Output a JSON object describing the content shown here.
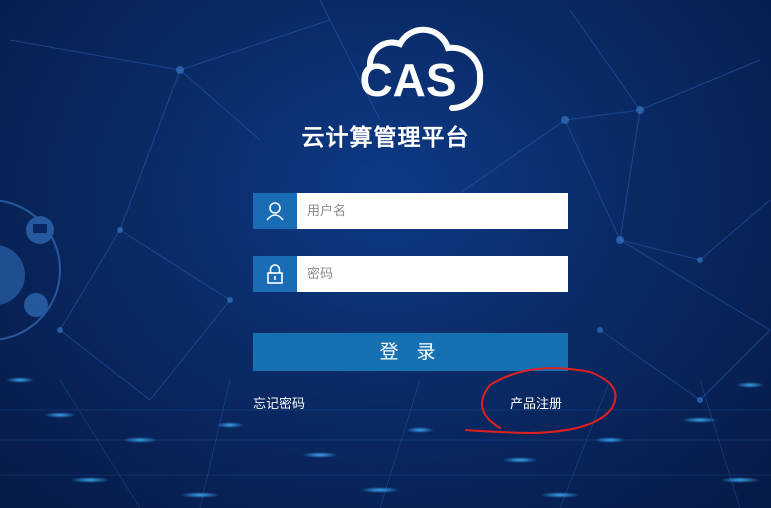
{
  "app": {
    "logo_text": "CAS",
    "subtitle": "云计算管理平台"
  },
  "form": {
    "username_placeholder": "用户名",
    "username_value": "",
    "password_placeholder": "密码",
    "password_value": "",
    "login_label": "登 录"
  },
  "links": {
    "forgot_password": "忘记密码",
    "product_register": "产品注册"
  },
  "icons": {
    "username": "user-icon",
    "password": "lock-icon"
  },
  "colors": {
    "accent": "#1671b2",
    "icon_bg": "#1a6db5",
    "annotation": "#e0201e"
  }
}
